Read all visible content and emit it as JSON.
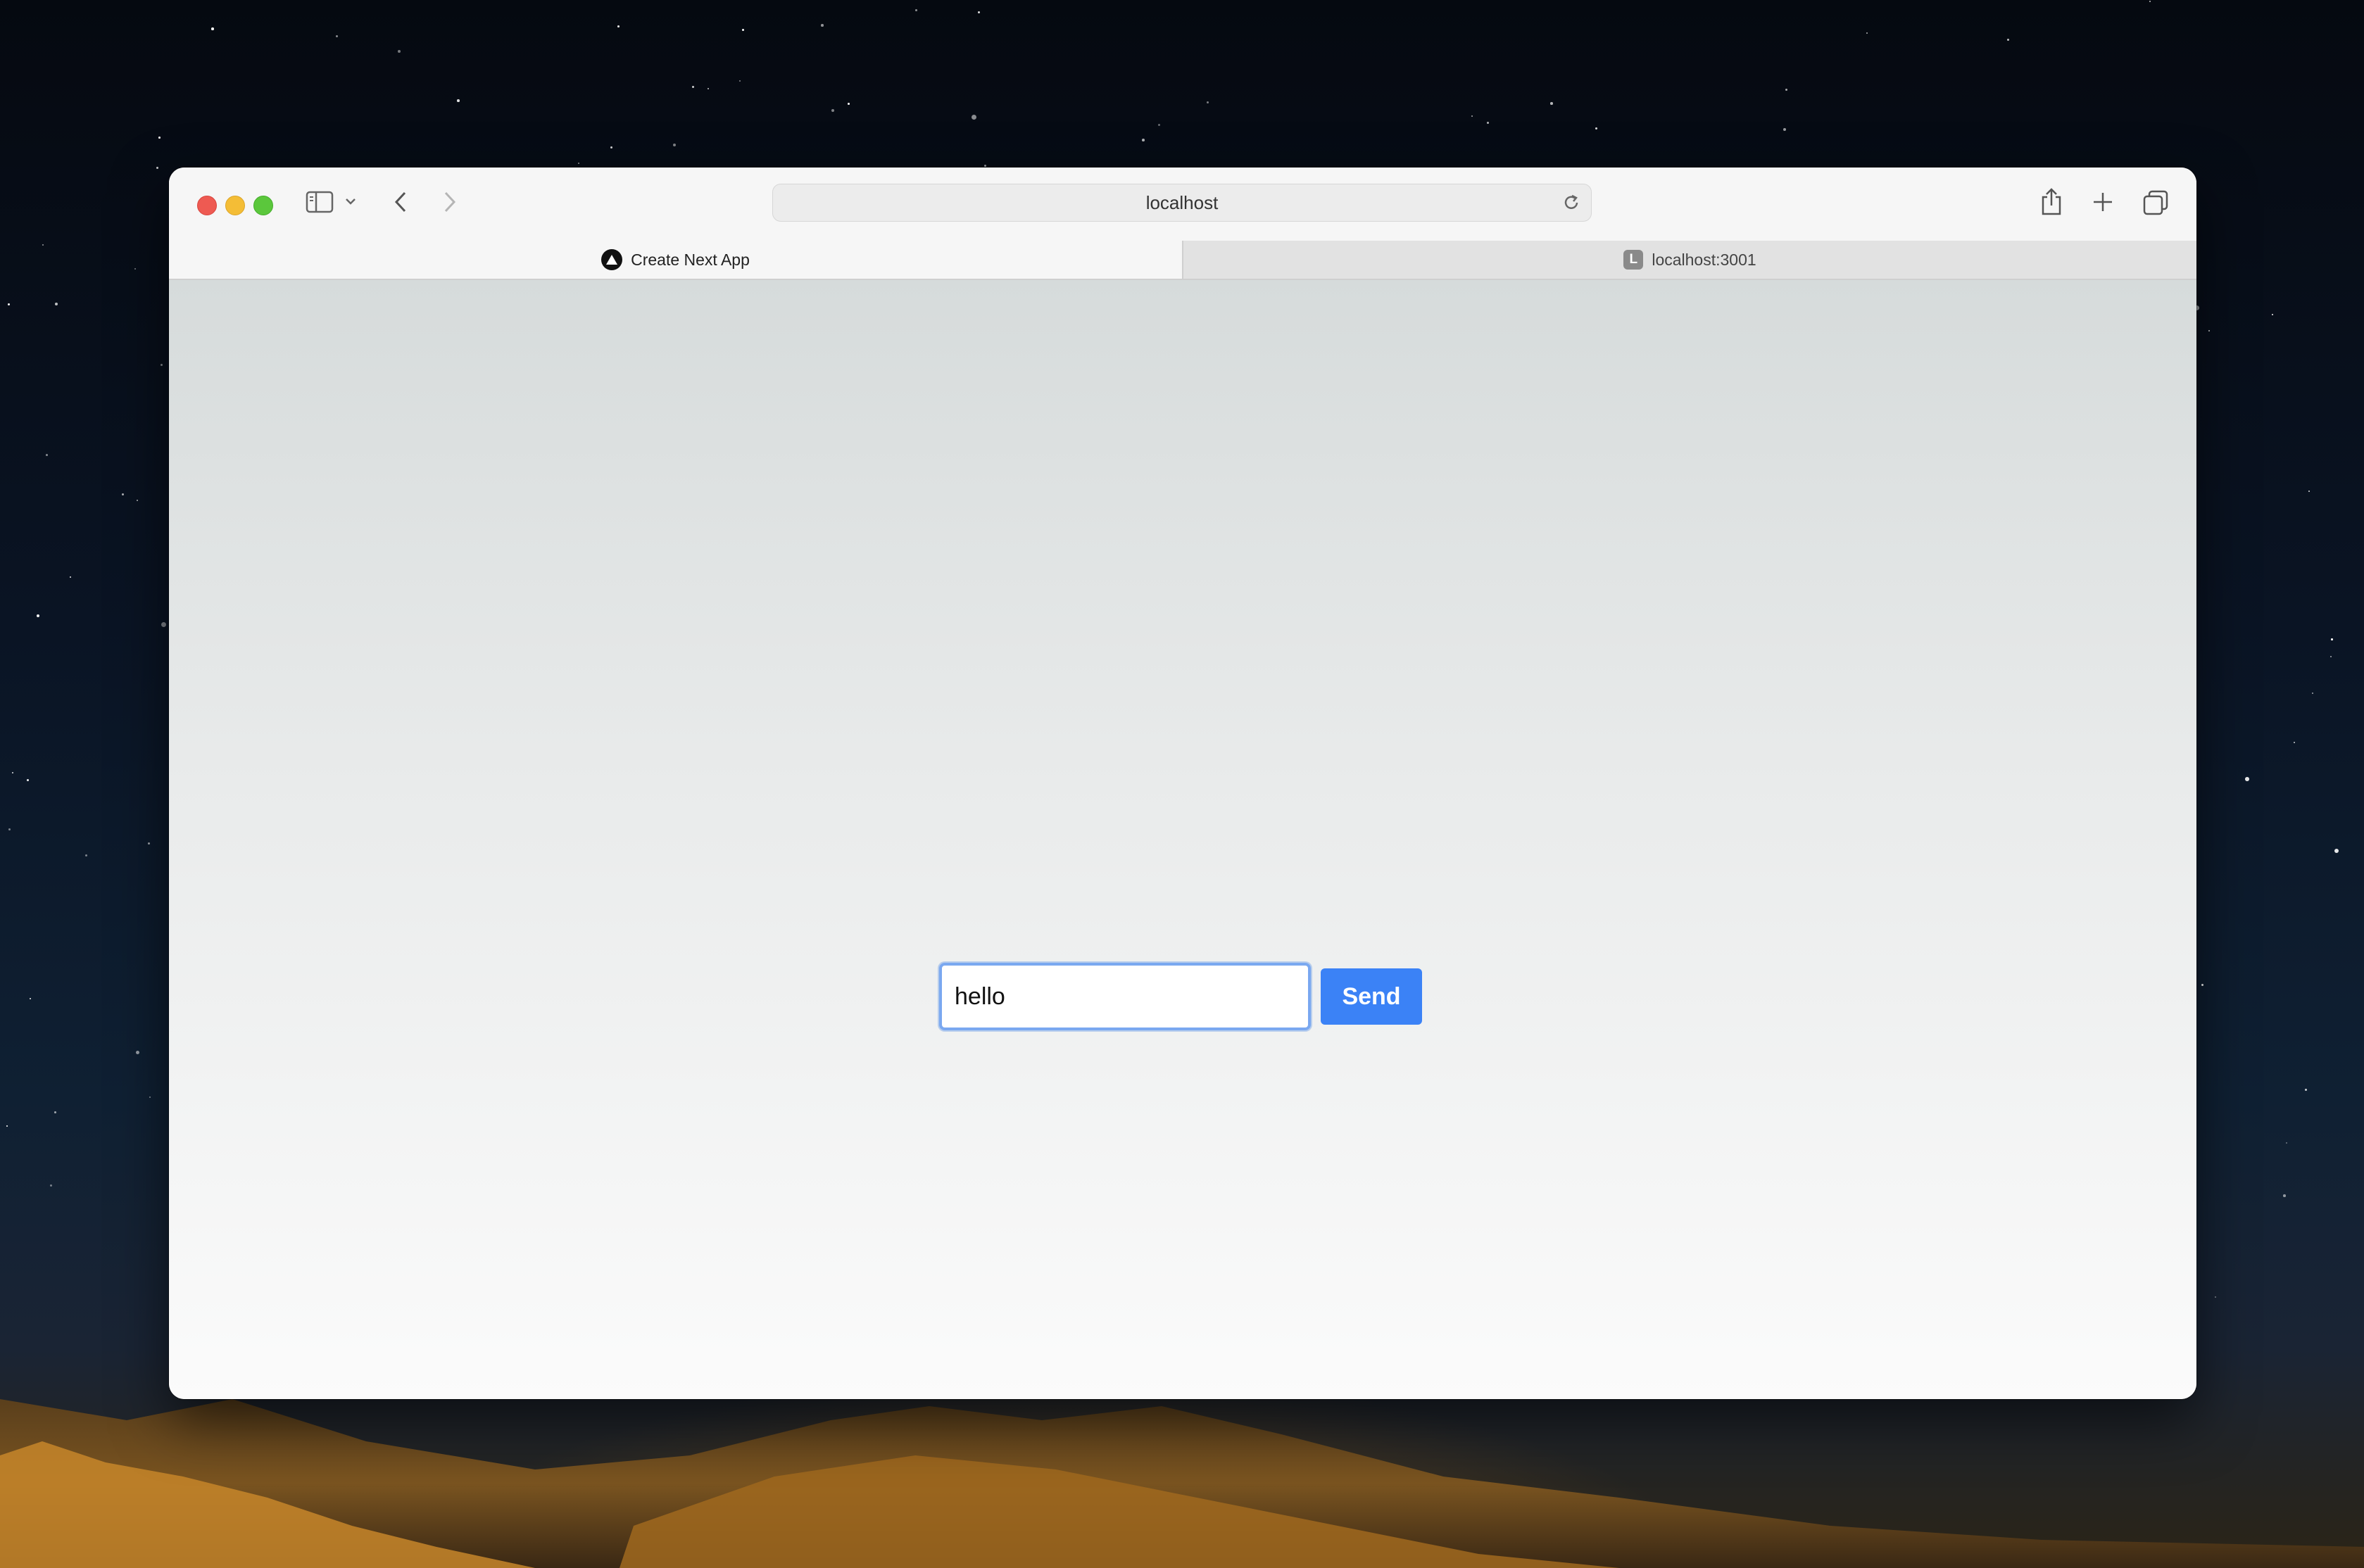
{
  "browser": {
    "address_bar": "localhost",
    "tabs": [
      {
        "label": "Create Next App",
        "active": true,
        "favicon": "nextjs-icon"
      },
      {
        "label": "localhost:3001",
        "active": false,
        "favicon": "letter-l-icon",
        "favicon_letter": "L"
      }
    ]
  },
  "page": {
    "message_input": {
      "value": "hello"
    },
    "send_button": {
      "label": "Send"
    }
  },
  "colors": {
    "accent": "#3b82f6",
    "focus_ring": "#7aa8f0"
  }
}
